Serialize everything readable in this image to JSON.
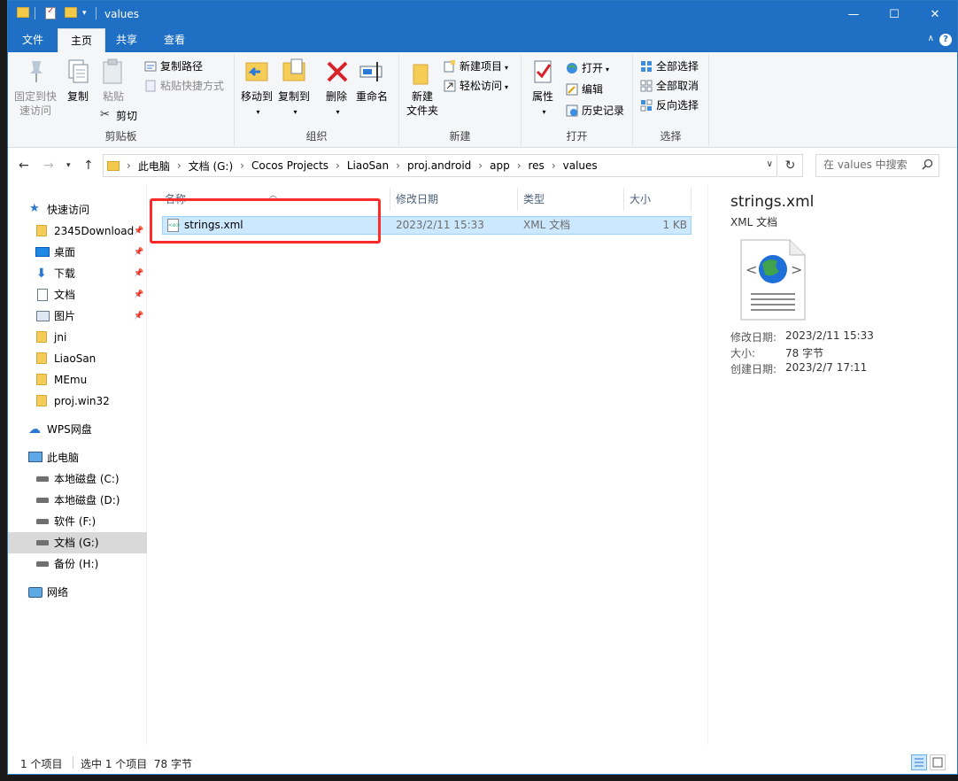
{
  "window": {
    "title": "values",
    "minimize_glyph": "—",
    "maximize_glyph": "☐",
    "close_glyph": "✕"
  },
  "tabs": [
    {
      "label": "文件"
    },
    {
      "label": "主页"
    },
    {
      "label": "共享"
    },
    {
      "label": "查看"
    }
  ],
  "ribbon": {
    "clipboard": {
      "label": "剪贴板",
      "pin_label": "固定到快\n速访问",
      "copy_label": "复制",
      "paste_label": "粘贴",
      "copy_path_label": "复制路径",
      "paste_shortcut_label": "粘贴快捷方式",
      "cut_label": "剪切"
    },
    "organize": {
      "label": "组织",
      "move_to_label": "移动到",
      "copy_to_label": "复制到",
      "delete_label": "删除",
      "rename_label": "重命名"
    },
    "new": {
      "label": "新建",
      "new_folder_label": "新建\n文件夹",
      "new_item_label": "新建项目",
      "easy_access_label": "轻松访问"
    },
    "open": {
      "label": "打开",
      "properties_label": "属性",
      "open_label": "打开",
      "edit_label": "编辑",
      "history_label": "历史记录"
    },
    "select": {
      "label": "选择",
      "select_all_label": "全部选择",
      "select_none_label": "全部取消",
      "invert_label": "反向选择"
    }
  },
  "address": {
    "crumbs": [
      "此电脑",
      "文档 (G:)",
      "Cocos Projects",
      "LiaoSan",
      "proj.android",
      "app",
      "res",
      "values"
    ],
    "search_placeholder": "在 values 中搜索"
  },
  "nav": {
    "quick_access": "快速访问",
    "quick_items": [
      {
        "label": "2345Download"
      },
      {
        "label": "桌面"
      },
      {
        "label": "下载"
      },
      {
        "label": "文档"
      },
      {
        "label": "图片"
      },
      {
        "label": "jni"
      },
      {
        "label": "LiaoSan"
      },
      {
        "label": "MEmu"
      },
      {
        "label": "proj.win32"
      }
    ],
    "wps": "WPS网盘",
    "this_pc": "此电脑",
    "drives": [
      {
        "label": "本地磁盘 (C:)"
      },
      {
        "label": "本地磁盘 (D:)"
      },
      {
        "label": "软件 (F:)"
      },
      {
        "label": "文档 (G:)"
      },
      {
        "label": "备份 (H:)"
      }
    ],
    "network": "网络"
  },
  "list": {
    "columns": [
      "名称",
      "修改日期",
      "类型",
      "大小"
    ],
    "rows": [
      {
        "name": "strings.xml",
        "modified": "2023/2/11 15:33",
        "type": "XML 文档",
        "size": "1 KB"
      }
    ]
  },
  "preview": {
    "name": "strings.xml",
    "type": "XML 文档",
    "props": [
      {
        "label": "修改日期:",
        "value": "2023/2/11 15:33"
      },
      {
        "label": "大小:",
        "value": "78 字节"
      },
      {
        "label": "创建日期:",
        "value": "2023/2/7 17:11"
      }
    ]
  },
  "status": {
    "count": "1 个项目",
    "selected": "选中 1 个项目  78 字节"
  },
  "colors": {
    "accent": "#1f6fc4",
    "selection": "#cce8ff",
    "highlight_box": "#ff2a2a"
  }
}
